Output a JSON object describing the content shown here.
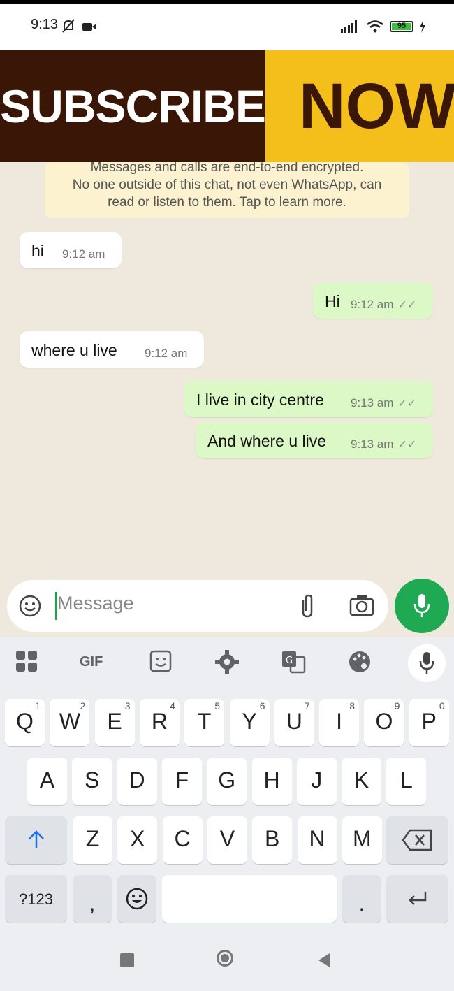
{
  "status": {
    "time": "9:13",
    "battery": "95"
  },
  "banner": {
    "left": "SUBSCRIBE",
    "right": "NOW"
  },
  "encryption": {
    "line1": "Messages and calls are end-to-end encrypted.",
    "line2": "No one outside of this chat, not even WhatsApp, can",
    "line3": "read or listen to them. Tap to learn more."
  },
  "messages": [
    {
      "dir": "in",
      "text": "hi",
      "time": "9:12 am"
    },
    {
      "dir": "out",
      "text": "Hi",
      "time": "9:12 am"
    },
    {
      "dir": "in",
      "text": "where u live",
      "time": "9:12 am"
    },
    {
      "dir": "out",
      "text": "I live in city centre",
      "time": "9:13 am"
    },
    {
      "dir": "out",
      "text": "And where u live",
      "time": "9:13 am"
    }
  ],
  "composer": {
    "placeholder": "Message"
  },
  "keyboard": {
    "toolbar": [
      "apps-icon",
      "GIF",
      "sticker-icon",
      "settings-icon",
      "translate-icon",
      "palette-icon",
      "mic-icon"
    ],
    "gif_label": "GIF",
    "row1": [
      {
        "k": "Q",
        "h": "1"
      },
      {
        "k": "W",
        "h": "2"
      },
      {
        "k": "E",
        "h": "3"
      },
      {
        "k": "R",
        "h": "4"
      },
      {
        "k": "T",
        "h": "5"
      },
      {
        "k": "Y",
        "h": "6"
      },
      {
        "k": "U",
        "h": "7"
      },
      {
        "k": "I",
        "h": "8"
      },
      {
        "k": "O",
        "h": "9"
      },
      {
        "k": "P",
        "h": "0"
      }
    ],
    "row2": [
      "A",
      "S",
      "D",
      "F",
      "G",
      "H",
      "J",
      "K",
      "L"
    ],
    "row3": [
      "Z",
      "X",
      "C",
      "V",
      "B",
      "N",
      "M"
    ],
    "symbols": "?123",
    "comma": ",",
    "period": "."
  },
  "colors": {
    "accent": "#1ea952",
    "outgoing": "#dcf8c6",
    "banner_dark": "#3a1606",
    "banner_yellow": "#f4bf1b"
  }
}
